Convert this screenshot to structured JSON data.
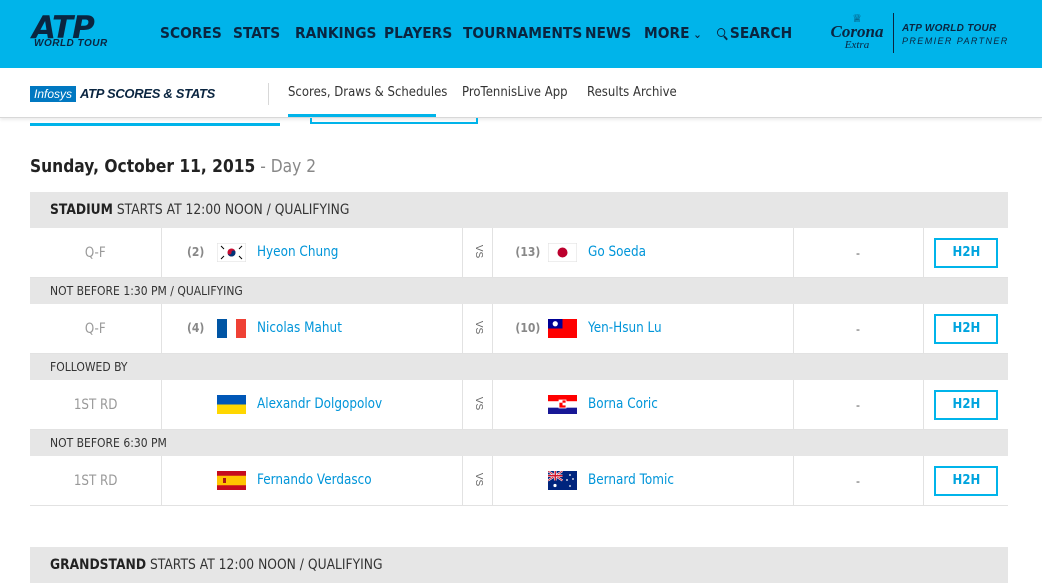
{
  "topnav": {
    "logo_atp": "ATP",
    "logo_wt": "WORLD TOUR",
    "items": [
      "SCORES",
      "STATS",
      "RANKINGS",
      "PLAYERS",
      "TOURNAMENTS",
      "NEWS",
      "MORE"
    ],
    "search_label": "SEARCH",
    "sponsor": {
      "name": "Corona",
      "sub": "Extra"
    },
    "partner": {
      "line1": "ATP WORLD TOUR",
      "line2": "PREMIER PARTNER"
    },
    "colors": {
      "bar": "#00b4ea",
      "text": "#0a2540"
    }
  },
  "subnav": {
    "infosys": "Infosys",
    "brand": "ATP SCORES & STATS",
    "links": [
      "Scores, Draws & Schedules",
      "ProTennisLive App",
      "Results Archive"
    ],
    "active": "Scores, Draws & Schedules"
  },
  "schedule": {
    "date": "Sunday, October 11, 2015",
    "day": " - Day 2",
    "sections": [
      {
        "court": "STADIUM",
        "note": " STARTS AT 12:00 NOON / QUALIFYING"
      },
      {
        "court": "GRANDSTAND",
        "note": " STARTS AT 12:00 NOON / QUALIFYING"
      }
    ],
    "subheaders": [
      "NOT BEFORE 1:30 PM / QUALIFYING",
      "FOLLOWED BY",
      "NOT BEFORE 6:30 PM"
    ],
    "vs": "VS",
    "h2h": "H2H",
    "matches": [
      {
        "round": "Q-F",
        "p1_seed": "(2)",
        "p1": "Hyeon Chung",
        "p1_flag": "KOR",
        "p2_seed": "(13)",
        "p2": "Go Soeda",
        "p2_flag": "JPN",
        "score": "-"
      },
      {
        "round": "Q-F",
        "p1_seed": "(4)",
        "p1": "Nicolas Mahut",
        "p1_flag": "FRA",
        "p2_seed": "(10)",
        "p2": "Yen-Hsun Lu",
        "p2_flag": "TPE",
        "score": "-"
      },
      {
        "round": "1ST RD",
        "p1_seed": "",
        "p1": "Alexandr Dolgopolov",
        "p1_flag": "UKR",
        "p2_seed": "",
        "p2": "Borna Coric",
        "p2_flag": "CRO",
        "score": "-"
      },
      {
        "round": "1ST RD",
        "p1_seed": "",
        "p1": "Fernando Verdasco",
        "p1_flag": "ESP",
        "p2_seed": "",
        "p2": "Bernard Tomic",
        "p2_flag": "AUS",
        "score": "-"
      }
    ]
  }
}
